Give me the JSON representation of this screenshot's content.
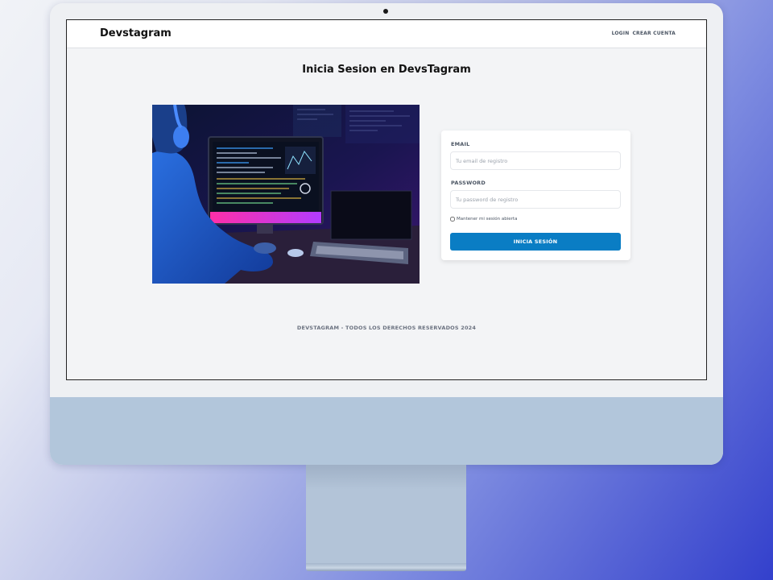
{
  "app": {
    "brand": "Devstagram",
    "nav": {
      "login": "LOGIN",
      "register": "CREAR CUENTA"
    }
  },
  "page": {
    "title": "Inicia Sesion en DevsTagram"
  },
  "hero": {
    "icon": "developer-at-computer-photo"
  },
  "form": {
    "email_label": "EMAIL",
    "email_placeholder": "Tu email de registro",
    "email_value": "",
    "password_label": "PASSWORD",
    "password_placeholder": "Tu password de registro",
    "password_value": "",
    "remember_label": "Mantener mi sesión abierta",
    "remember_checked": false,
    "submit_label": "INICIA SESIÓN"
  },
  "footer": {
    "text": "DEVSTAGRAM - TODOS LOS DERECHOS RESERVADOS 2024"
  },
  "colors": {
    "primary_button": "#0a7dc4",
    "page_bg": "#f3f4f6",
    "monitor_chin": "#b2c6db"
  }
}
